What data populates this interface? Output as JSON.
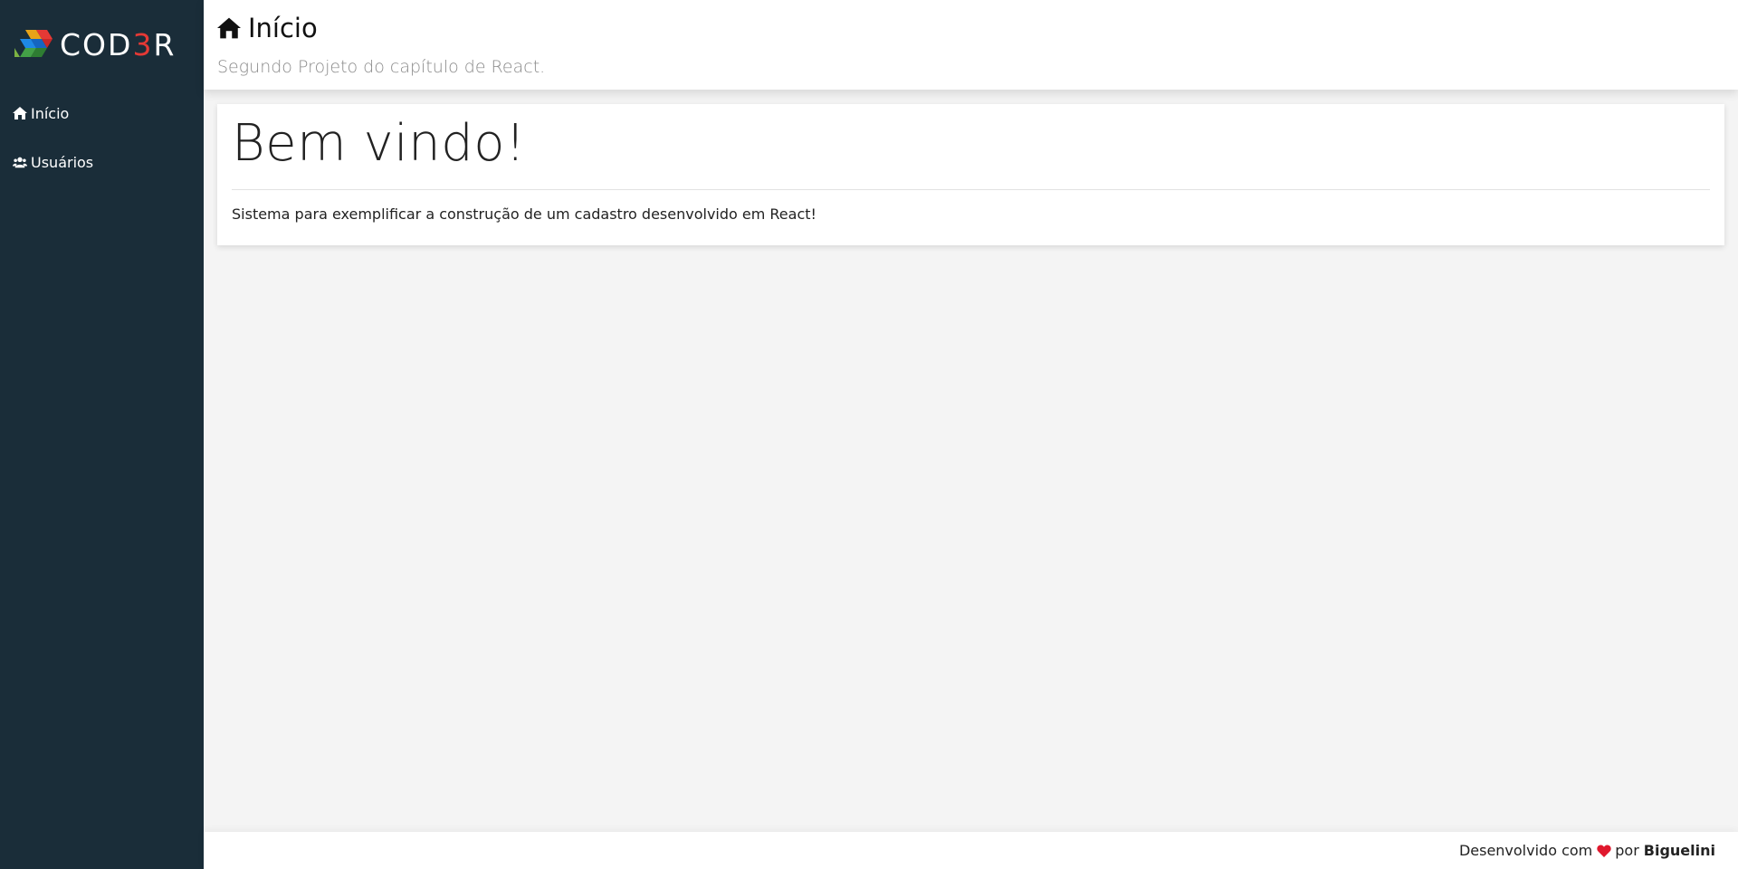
{
  "brand": {
    "logo_text": "COD",
    "logo_accent": "3",
    "logo_suffix": "R"
  },
  "sidebar": {
    "items": [
      {
        "icon": "home-icon",
        "label": "Início"
      },
      {
        "icon": "users-icon",
        "label": "Usuários"
      }
    ]
  },
  "header": {
    "icon": "home-icon",
    "title": "Início",
    "subtitle": "Segundo Projeto do capítulo de React."
  },
  "main": {
    "heading": "Bem vindo!",
    "description": "Sistema para exemplificar a construção de um cadastro desenvolvido em React!"
  },
  "footer": {
    "prefix": "Desenvolvido com",
    "icon": "heart-icon",
    "middle": "por",
    "author": "Biguelini"
  },
  "colors": {
    "sidebar_bg": "#1a2d39",
    "page_bg": "#f4f4f4",
    "accent_red": "#e53935",
    "heart": "#e0182d"
  }
}
